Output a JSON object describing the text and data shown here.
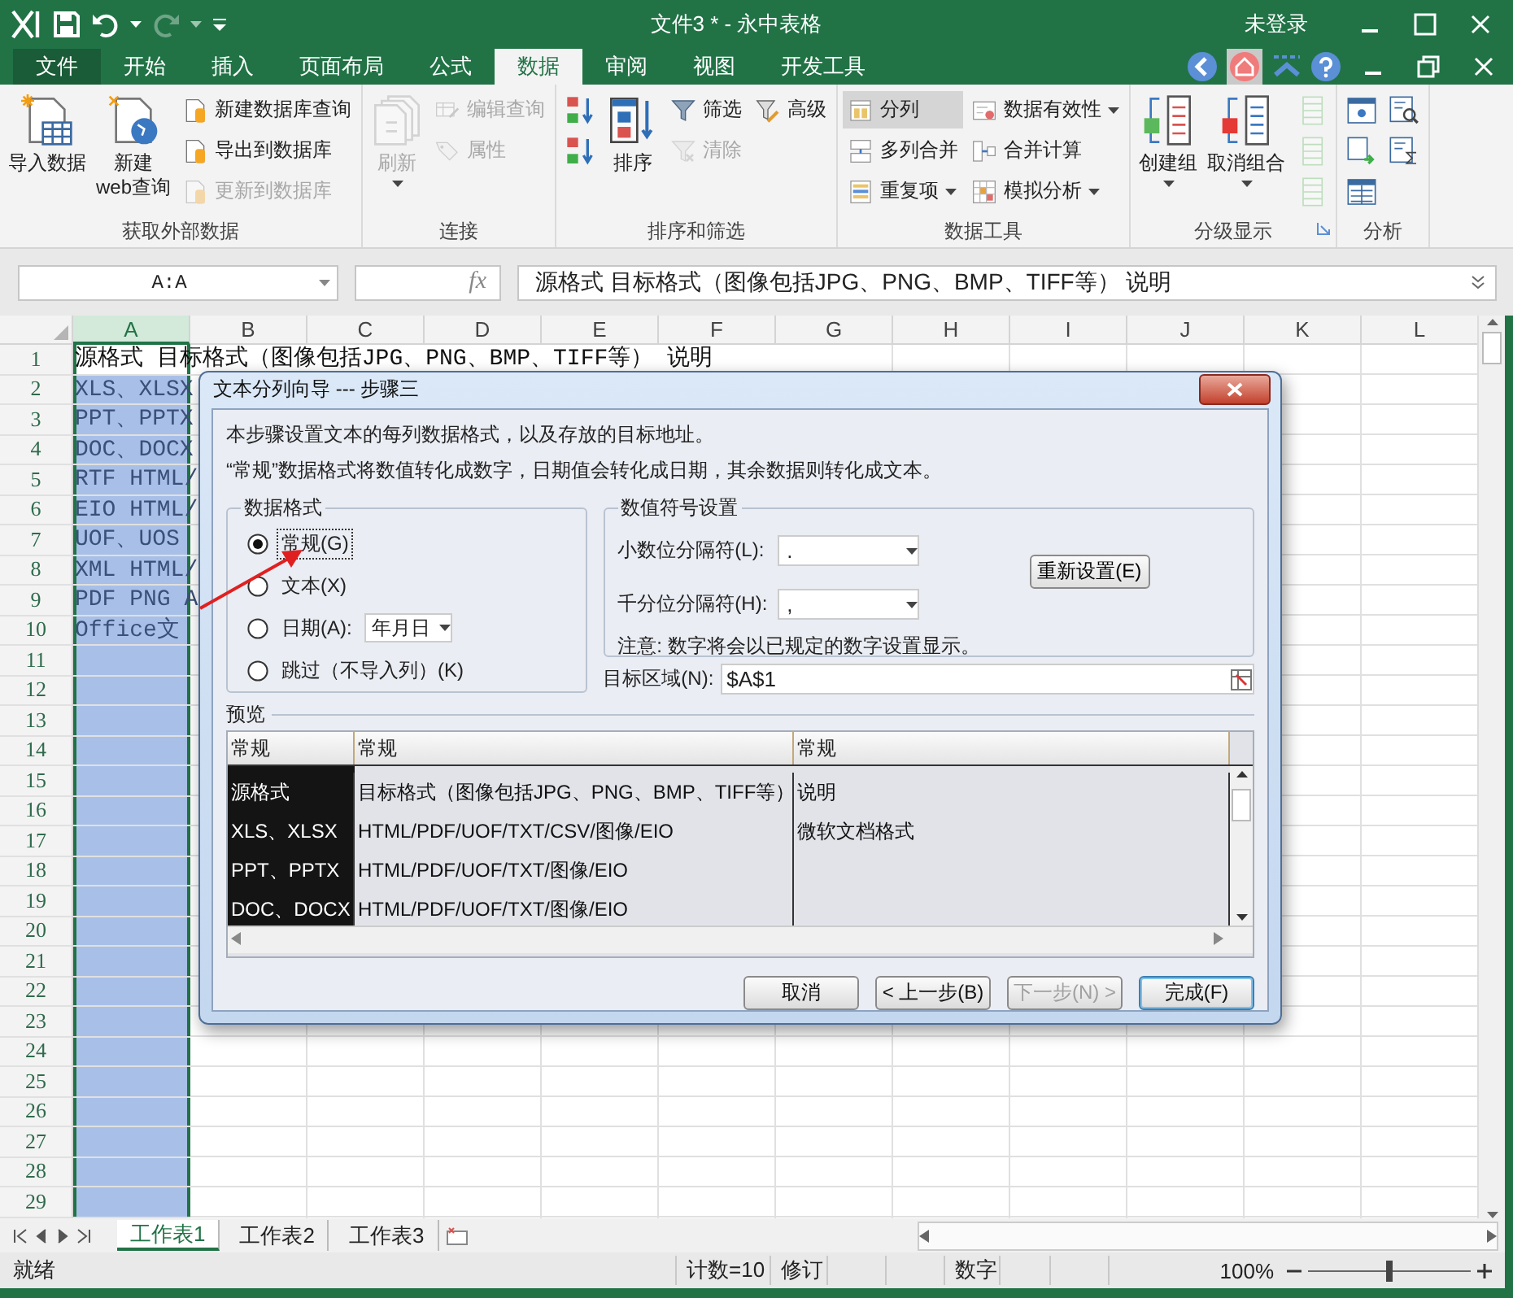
{
  "window": {
    "title": "文件3 * - 永中表格",
    "account": "未登录"
  },
  "menu_tabs": [
    {
      "label": "文件",
      "kind": "file",
      "selected": false
    },
    {
      "label": "开始",
      "kind": "tab",
      "selected": false
    },
    {
      "label": "插入",
      "kind": "tab",
      "selected": false
    },
    {
      "label": "页面布局",
      "kind": "tab",
      "selected": false
    },
    {
      "label": "公式",
      "kind": "tab",
      "selected": false
    },
    {
      "label": "数据",
      "kind": "tab",
      "selected": true
    },
    {
      "label": "审阅",
      "kind": "tab",
      "selected": false
    },
    {
      "label": "视图",
      "kind": "tab",
      "selected": false
    },
    {
      "label": "开发工具",
      "kind": "tab",
      "selected": false
    }
  ],
  "ribbon": [
    {
      "label": "获取外部数据",
      "columns": [
        [
          {
            "kind": "large",
            "label": "导入数据",
            "disabled": false,
            "highlighted": false,
            "dropdown": false
          }
        ],
        [
          {
            "kind": "large",
            "label": "新建\nweb查询",
            "disabled": false,
            "highlighted": false,
            "dropdown": false
          }
        ],
        [
          {
            "kind": "small",
            "label": "新建数据库查询",
            "disabled": false,
            "highlighted": false,
            "dropdown": false
          },
          {
            "kind": "small",
            "label": "导出到数据库",
            "disabled": false,
            "highlighted": false,
            "dropdown": false
          },
          {
            "kind": "small",
            "label": "更新到数据库",
            "disabled": true,
            "highlighted": false,
            "dropdown": false
          }
        ]
      ]
    },
    {
      "label": "连接",
      "columns": [
        [
          {
            "kind": "large",
            "label": "刷新",
            "disabled": true,
            "highlighted": false,
            "dropdown": true
          }
        ],
        [
          {
            "kind": "small",
            "label": "编辑查询",
            "disabled": true,
            "highlighted": false,
            "dropdown": false
          },
          {
            "kind": "small",
            "label": "属性",
            "disabled": true,
            "highlighted": false,
            "dropdown": false
          }
        ]
      ]
    },
    {
      "label": "排序和筛选",
      "columns": [
        [
          {
            "kind": "icon",
            "disabled": false
          },
          {
            "kind": "icon",
            "disabled": false
          }
        ],
        [
          {
            "kind": "large",
            "label": "排序",
            "disabled": false,
            "highlighted": false,
            "dropdown": false
          }
        ],
        [
          {
            "kind": "small",
            "label": "筛选",
            "disabled": false,
            "highlighted": false,
            "dropdown": false
          },
          {
            "kind": "small",
            "label": "清除",
            "disabled": true,
            "highlighted": false,
            "dropdown": false
          }
        ],
        [
          {
            "kind": "small",
            "label": "高级",
            "disabled": false,
            "highlighted": false,
            "dropdown": false
          }
        ]
      ]
    },
    {
      "label": "数据工具",
      "columns": [
        [
          {
            "kind": "small",
            "label": "分列",
            "disabled": false,
            "highlighted": true,
            "dropdown": false
          },
          {
            "kind": "small",
            "label": "多列合并",
            "disabled": false,
            "highlighted": false,
            "dropdown": false
          },
          {
            "kind": "small",
            "label": "重复项",
            "disabled": false,
            "highlighted": false,
            "dropdown": true
          }
        ],
        [
          {
            "kind": "small",
            "label": "数据有效性",
            "disabled": false,
            "highlighted": false,
            "dropdown": true
          },
          {
            "kind": "small",
            "label": "合并计算",
            "disabled": false,
            "highlighted": false,
            "dropdown": false
          },
          {
            "kind": "small",
            "label": "模拟分析",
            "disabled": false,
            "highlighted": false,
            "dropdown": true
          }
        ]
      ]
    },
    {
      "label": "分级显示",
      "launcher": true,
      "columns": [
        [
          {
            "kind": "large",
            "label": "创建组",
            "disabled": false,
            "highlighted": false,
            "dropdown": true
          }
        ],
        [
          {
            "kind": "large",
            "label": "取消组合",
            "disabled": false,
            "highlighted": false,
            "dropdown": true
          }
        ],
        [
          {
            "kind": "icon",
            "disabled": true
          },
          {
            "kind": "icon",
            "disabled": true
          },
          {
            "kind": "icon",
            "disabled": true
          }
        ]
      ]
    },
    {
      "label": "分析",
      "columns": [
        [
          {
            "kind": "icon",
            "disabled": false
          },
          {
            "kind": "icon",
            "disabled": false
          },
          {
            "kind": "icon",
            "disabled": false
          }
        ],
        [
          {
            "kind": "icon",
            "disabled": false
          },
          {
            "kind": "icon",
            "disabled": false
          }
        ]
      ]
    }
  ],
  "sheet": {
    "name_box": "A:A",
    "function_label": "fx",
    "formula": "源格式 目标格式（图像包括JPG、PNG、BMP、TIFF等） 说明",
    "columns": [
      {
        "label": "A",
        "selected": true
      },
      {
        "label": "B",
        "selected": false
      },
      {
        "label": "C",
        "selected": false
      },
      {
        "label": "D",
        "selected": false
      },
      {
        "label": "E",
        "selected": false
      },
      {
        "label": "F",
        "selected": false
      },
      {
        "label": "G",
        "selected": false
      },
      {
        "label": "H",
        "selected": false
      },
      {
        "label": "I",
        "selected": false
      },
      {
        "label": "J",
        "selected": false
      },
      {
        "label": "K",
        "selected": false
      },
      {
        "label": "L",
        "selected": false
      }
    ],
    "rows": [
      {
        "label": "1",
        "active": true,
        "cells": [
          "源格式 目标格式（图像包括JPG、PNG、BMP、TIFF等） 说明"
        ]
      },
      {
        "label": "2",
        "active": false,
        "cells": [
          "XLS、XLSX"
        ]
      },
      {
        "label": "3",
        "active": false,
        "cells": [
          "PPT、PPTX"
        ]
      },
      {
        "label": "4",
        "active": false,
        "cells": [
          "DOC、DOCX"
        ]
      },
      {
        "label": "5",
        "active": false,
        "cells": [
          "RTF HTML/"
        ]
      },
      {
        "label": "6",
        "active": false,
        "cells": [
          "EIO HTML/"
        ]
      },
      {
        "label": "7",
        "active": false,
        "cells": [
          "UOF、UOS"
        ]
      },
      {
        "label": "8",
        "active": false,
        "cells": [
          "XML HTML/"
        ]
      },
      {
        "label": "9",
        "active": false,
        "cells": [
          "PDF PNG A"
        ]
      },
      {
        "label": "10",
        "active": false,
        "cells": [
          "Office文"
        ]
      },
      {
        "label": "11",
        "active": false
      },
      {
        "label": "12",
        "active": false
      },
      {
        "label": "13",
        "active": false
      },
      {
        "label": "14",
        "active": false
      },
      {
        "label": "15",
        "active": false
      },
      {
        "label": "16",
        "active": false
      },
      {
        "label": "17",
        "active": false
      },
      {
        "label": "18",
        "active": false
      },
      {
        "label": "19",
        "active": false
      },
      {
        "label": "20",
        "active": false
      },
      {
        "label": "21",
        "active": false
      },
      {
        "label": "22",
        "active": false
      },
      {
        "label": "23",
        "active": false
      },
      {
        "label": "24",
        "active": false
      },
      {
        "label": "25",
        "active": false
      },
      {
        "label": "26",
        "active": false
      },
      {
        "label": "27",
        "active": false
      },
      {
        "label": "28",
        "active": false
      },
      {
        "label": "29",
        "active": false
      }
    ]
  },
  "dialog": {
    "title": "文本分列向导 --- 步骤三",
    "intro": [
      "本步骤设置文本的每列数据格式，以及存放的目标地址。",
      "“常规”数据格式将数值转化成数字，日期值会转化成日期，其余数据则转化成文本。"
    ],
    "format_group": {
      "label": "数据格式",
      "options": [
        {
          "label": "常规(G)",
          "selected": true,
          "focused": true
        },
        {
          "label": "文本(X)",
          "selected": false,
          "focused": false
        },
        {
          "label": "日期(A):",
          "selected": false,
          "focused": false,
          "select_value": "年月日"
        },
        {
          "label": "跳过（不导入列）(K)",
          "selected": false,
          "focused": false
        }
      ]
    },
    "separator_group": {
      "label": "数值符号设置",
      "fields": [
        {
          "label": "小数位分隔符(L):",
          "value": "."
        },
        {
          "label": "千分位分隔符(H):",
          "value": ","
        }
      ],
      "reset_button": "重新设置(E)",
      "note": "注意: 数字将会以已规定的数字设置显示。"
    },
    "destination": {
      "label": "目标区域(N):",
      "value": "$A$1"
    },
    "preview": {
      "label": "预览",
      "columns": [
        {
          "label": "常规",
          "selected": true
        },
        {
          "label": "常规",
          "selected": false
        },
        {
          "label": "常规",
          "selected": false
        }
      ],
      "rows": [
        [
          "源格式",
          "目标格式（图像包括JPG、PNG、BMP、TIFF等）",
          "说明"
        ],
        [
          "XLS、XLSX",
          "HTML/PDF/UOF/TXT/CSV/图像/EIO",
          "微软文档格式"
        ],
        [
          "PPT、PPTX",
          "HTML/PDF/UOF/TXT/图像/EIO"
        ],
        [
          "DOC、DOCX",
          "HTML/PDF/UOF/TXT/图像/EIO"
        ]
      ]
    },
    "buttons": [
      {
        "label": "取消",
        "disabled": false,
        "default": false
      },
      {
        "label": "< 上一步(B)",
        "disabled": false,
        "default": false
      },
      {
        "label": "下一步(N) >",
        "disabled": true,
        "default": false
      },
      {
        "label": "完成(F)",
        "disabled": false,
        "default": true
      }
    ]
  },
  "sheet_tabs": [
    {
      "label": "工作表1",
      "selected": true
    },
    {
      "label": "工作表2",
      "selected": false
    },
    {
      "label": "工作表3",
      "selected": false
    }
  ],
  "status": {
    "ready": "就绪",
    "count": "计数=10",
    "revision": "修订",
    "mode": "数字",
    "zoom": "100%",
    "zoom_slider": {
      "level": 0.5
    }
  }
}
